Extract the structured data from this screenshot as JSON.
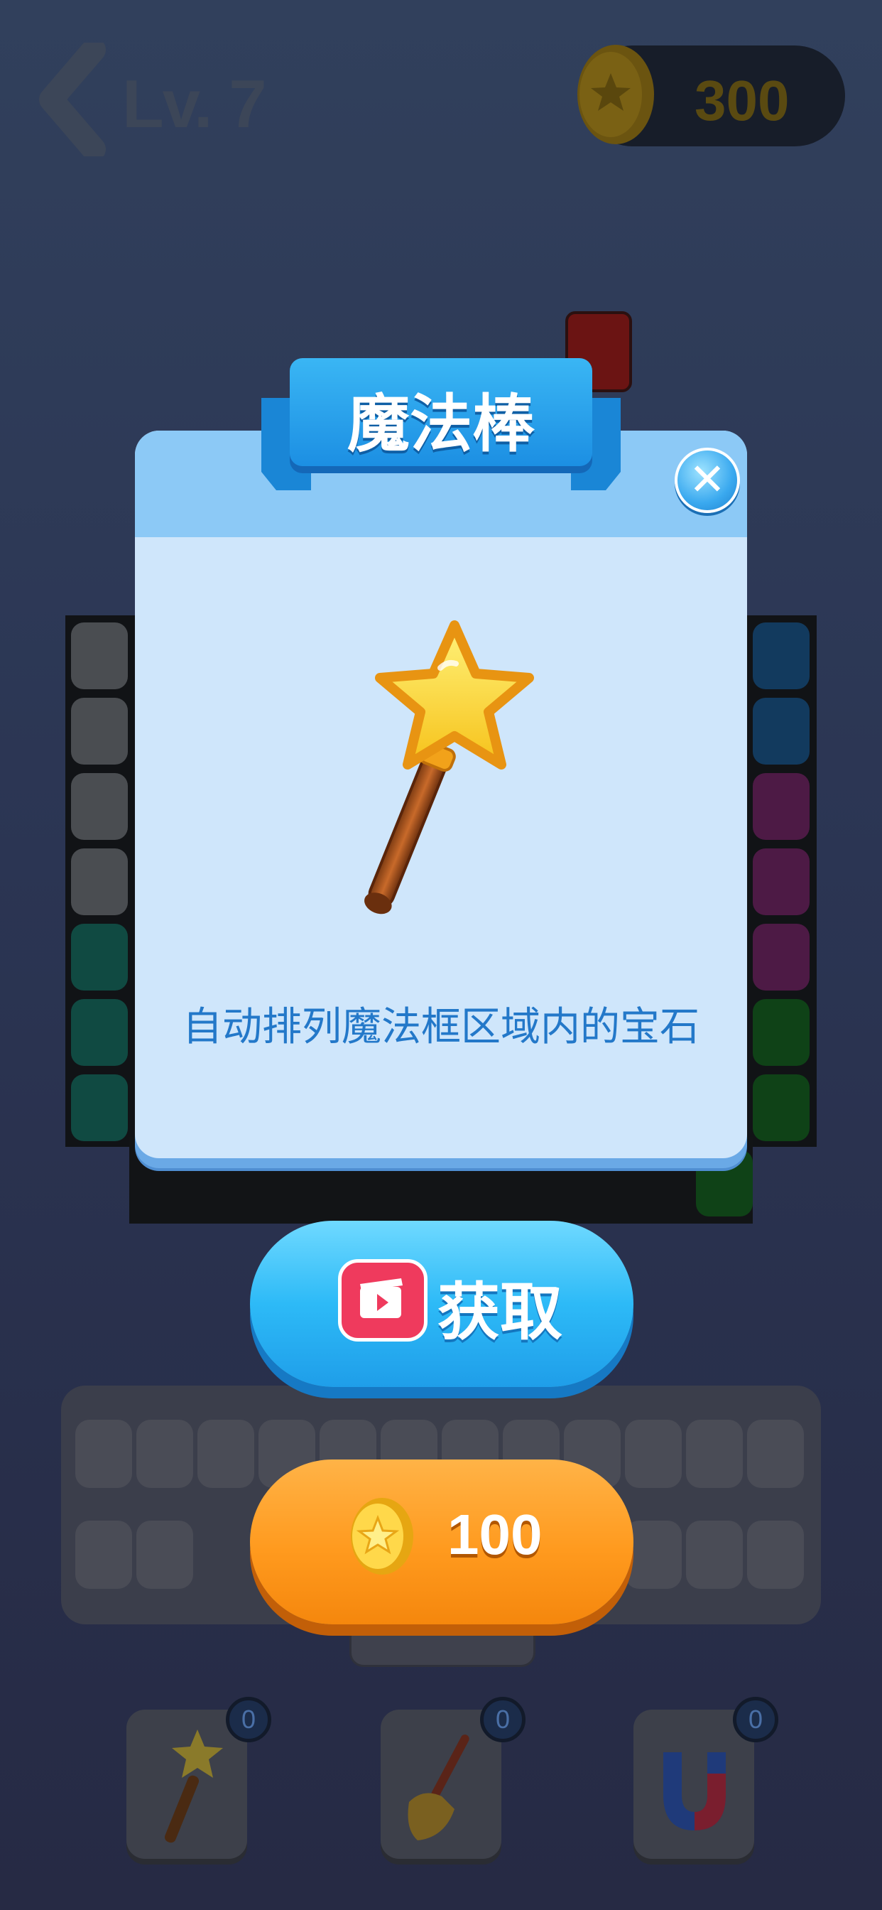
{
  "header": {
    "level": "Lv. 7",
    "coins": "300"
  },
  "dialog": {
    "title": "魔法棒",
    "description": "自动排列魔法框区域内的宝石",
    "close_icon": "close-icon",
    "item_icon": "magic-wand-icon"
  },
  "buttons": {
    "get_label": "获取",
    "get_icon": "video-ad-icon",
    "price": "100",
    "price_icon": "coin-icon"
  },
  "items": [
    {
      "name": "magic-wand",
      "icon": "magic-wand-icon",
      "count": "0"
    },
    {
      "name": "broom",
      "icon": "broom-icon",
      "count": "0"
    },
    {
      "name": "magnet",
      "icon": "magnet-icon",
      "count": "0"
    }
  ],
  "colors": {
    "accent_blue": "#2dbaf7",
    "accent_orange": "#ff9a1e",
    "description_text": "#2378c9"
  }
}
